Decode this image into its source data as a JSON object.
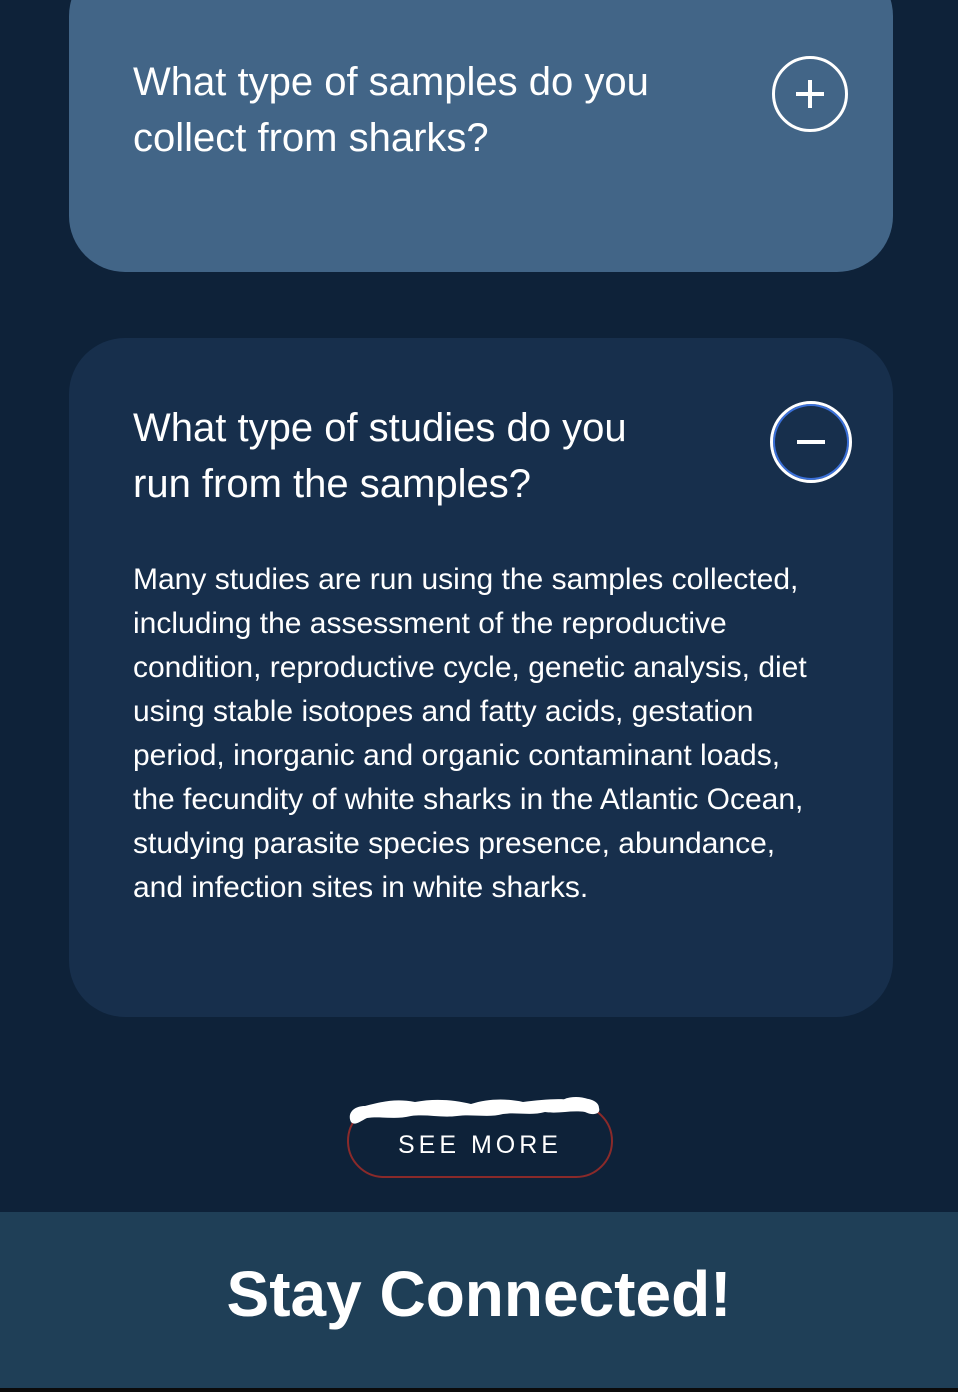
{
  "faq": {
    "items": [
      {
        "question": "What type of samples do you collect from sharks?",
        "state": "collapsed",
        "toggle_icon": "plus-icon"
      },
      {
        "question": "What type of studies do you run from the samples?",
        "state": "expanded",
        "toggle_icon": "minus-icon",
        "answer": "Many studies are run using the samples collected, including the assessment of the reproductive condition, reproductive cycle, genetic analysis, diet using stable isotopes and fatty acids, gestation period, inorganic and organic contaminant loads, the fecundity of white sharks in the Atlantic Ocean, studying parasite species presence, abundance, and infection sites in white sharks."
      }
    ]
  },
  "see_more": {
    "label": "SEE MORE"
  },
  "stay_connected": {
    "title": "Stay Connected!"
  },
  "colors": {
    "page_background": "#0e2239",
    "collapsed_card": "#426587",
    "expanded_card": "#172f4c",
    "footer_background": "#1f3f57",
    "see_more_border": "#8a2a2a",
    "focus_ring": "#3a6fd8"
  }
}
